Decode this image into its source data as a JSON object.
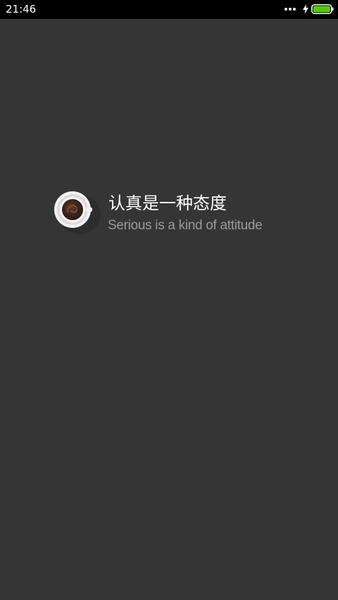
{
  "status_bar": {
    "time": "21:46",
    "icons": [
      "more-dots-icon",
      "charging-bolt-icon",
      "battery-icon"
    ],
    "battery_color": "#4cd000"
  },
  "splash": {
    "logo_icon": "coffee-cup-icon",
    "title": "认真是一种态度",
    "subtitle": "Serious is a kind of attitude"
  },
  "colors": {
    "background": "#353535",
    "status_bar": "#000000",
    "title_text": "#ffffff",
    "subtitle_text": "#9a9a9a",
    "coffee": "#3a2418"
  }
}
